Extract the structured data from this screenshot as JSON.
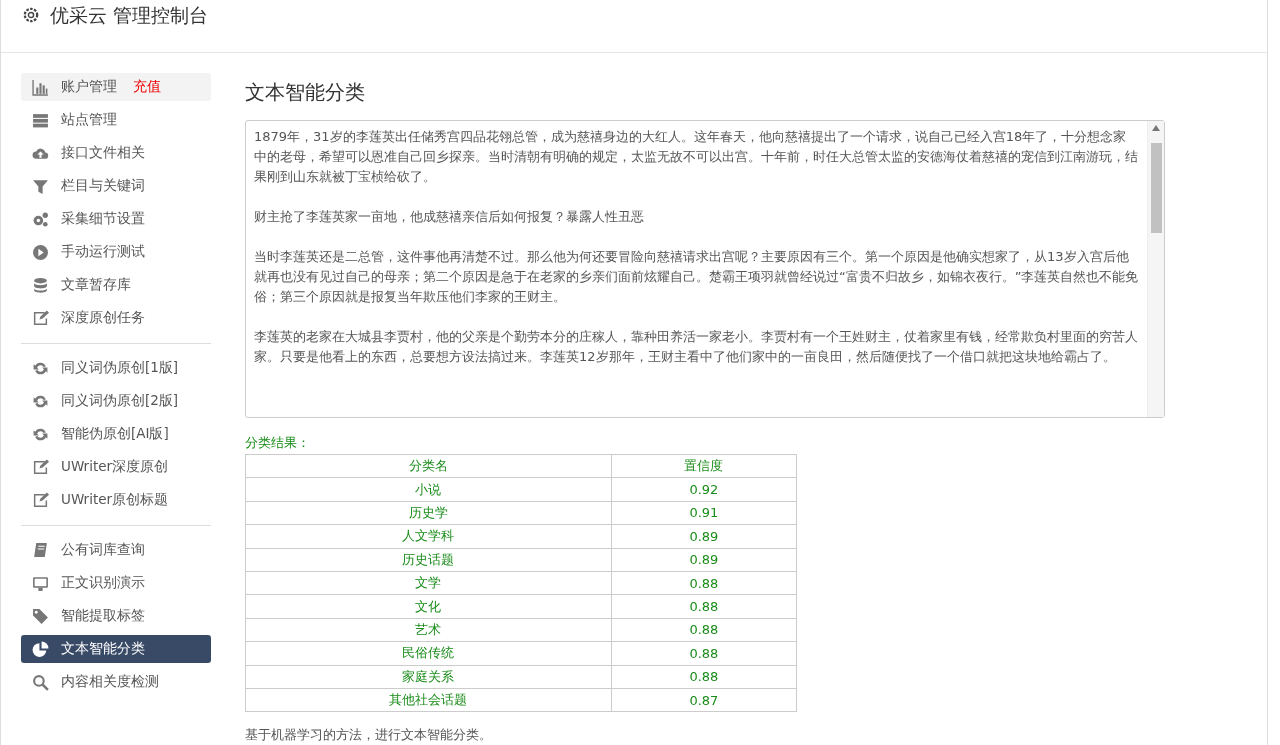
{
  "header": {
    "title": "优采云 管理控制台"
  },
  "sidebar": {
    "groups": [
      [
        {
          "label": "账户管理",
          "badge": "充值",
          "selected": false,
          "highlighted": true
        },
        {
          "label": "站点管理",
          "selected": false,
          "highlighted": false
        },
        {
          "label": "接口文件相关",
          "selected": false,
          "highlighted": false
        },
        {
          "label": "栏目与关键词",
          "selected": false,
          "highlighted": false
        },
        {
          "label": "采集细节设置",
          "selected": false,
          "highlighted": false
        },
        {
          "label": "手动运行测试",
          "selected": false,
          "highlighted": false
        },
        {
          "label": "文章暂存库",
          "selected": false,
          "highlighted": false
        },
        {
          "label": "深度原创任务",
          "selected": false,
          "highlighted": false
        }
      ],
      [
        {
          "label": "同义词伪原创[1版]",
          "selected": false,
          "highlighted": false
        },
        {
          "label": "同义词伪原创[2版]",
          "selected": false,
          "highlighted": false
        },
        {
          "label": "智能伪原创[AI版]",
          "selected": false,
          "highlighted": false
        },
        {
          "label": "UWriter深度原创",
          "selected": false,
          "highlighted": false
        },
        {
          "label": "UWriter原创标题",
          "selected": false,
          "highlighted": false
        }
      ],
      [
        {
          "label": "公有词库查询",
          "selected": false,
          "highlighted": false
        },
        {
          "label": "正文识别演示",
          "selected": false,
          "highlighted": false
        },
        {
          "label": "智能提取标签",
          "selected": false,
          "highlighted": false
        },
        {
          "label": "文本智能分类",
          "selected": true,
          "highlighted": false
        },
        {
          "label": "内容相关度检测",
          "selected": false,
          "highlighted": false
        }
      ]
    ]
  },
  "main": {
    "title": "文本智能分类",
    "article": [
      "1879年，31岁的李莲英出任储秀宫四品花翎总管，成为慈禧身边的大红人。这年春天，他向慈禧提出了一个请求，说自己已经入宫18年了，十分想念家中的老母，希望可以恩准自己回乡探亲。当时清朝有明确的规定，太监无故不可以出宫。十年前，时任大总管太监的安德海仗着慈禧的宠信到江南游玩，结果刚到山东就被丁宝桢给砍了。",
      "财主抢了李莲英家一亩地，他成慈禧亲信后如何报复？暴露人性丑恶",
      "当时李莲英还是二总管，这件事他再清楚不过。那么他为何还要冒险向慈禧请求出宫呢？主要原因有三个。第一个原因是他确实想家了，从13岁入宫后他就再也没有见过自己的母亲；第二个原因是急于在老家的乡亲们面前炫耀自己。楚霸王项羽就曾经说过“富贵不归故乡，如锦衣夜行。”李莲英自然也不能免俗；第三个原因就是报复当年欺压他们李家的王财主。",
      "李莲英的老家在大城县李贾村，他的父亲是个勤劳本分的庄稼人，靠种田养活一家老小。李贾村有一个王姓财主，仗着家里有钱，经常欺负村里面的穷苦人家。只要是他看上的东西，总要想方设法搞过来。李莲英12岁那年，王财主看中了他们家中的一亩良田，然后随便找了一个借口就把这块地给霸占了。"
    ],
    "result_label": "分类结果：",
    "table": {
      "columns": [
        "分类名",
        "置信度"
      ],
      "rows": [
        [
          "小说",
          "0.92"
        ],
        [
          "历史学",
          "0.91"
        ],
        [
          "人文学科",
          "0.89"
        ],
        [
          "历史话题",
          "0.89"
        ],
        [
          "文学",
          "0.88"
        ],
        [
          "文化",
          "0.88"
        ],
        [
          "艺术",
          "0.88"
        ],
        [
          "民俗传统",
          "0.88"
        ],
        [
          "家庭关系",
          "0.88"
        ],
        [
          "其他社会话题",
          "0.87"
        ]
      ]
    },
    "footnote": "基于机器学习的方法，进行文本智能分类。"
  }
}
